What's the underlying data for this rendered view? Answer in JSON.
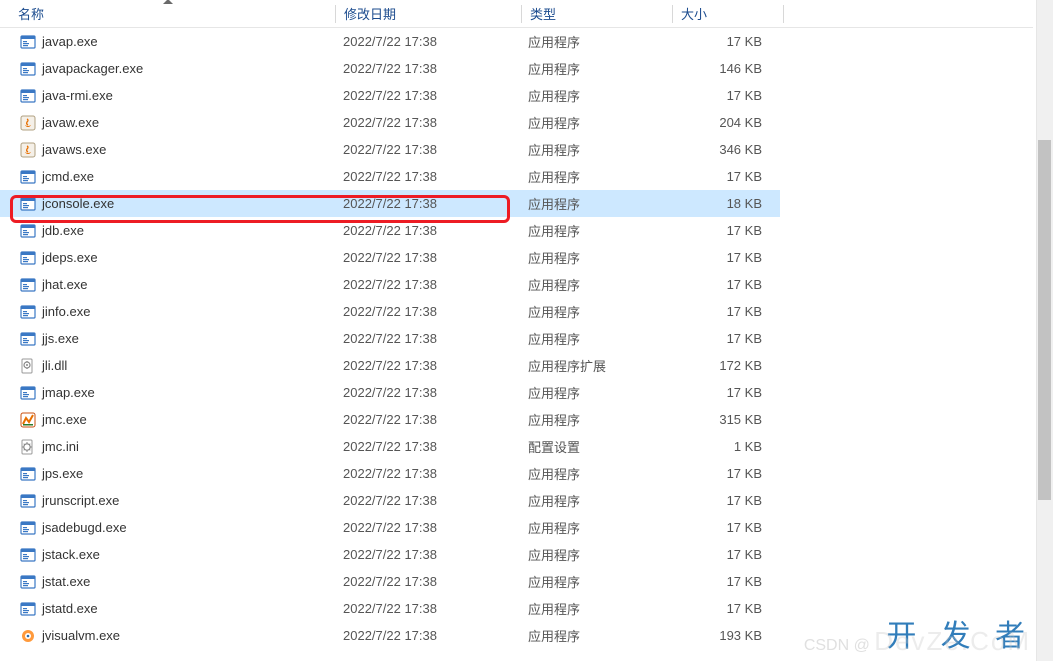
{
  "columns": {
    "name": "名称",
    "date": "修改日期",
    "type": "类型",
    "size": "大小"
  },
  "file_types": {
    "app": "应用程序",
    "app_ext": "应用程序扩展",
    "config": "配置设置"
  },
  "files": [
    {
      "name": "javap.exe",
      "date": "2022/7/22 17:38",
      "type": "app",
      "size": "17 KB",
      "icon": "exe"
    },
    {
      "name": "javapackager.exe",
      "date": "2022/7/22 17:38",
      "type": "app",
      "size": "146 KB",
      "icon": "exe"
    },
    {
      "name": "java-rmi.exe",
      "date": "2022/7/22 17:38",
      "type": "app",
      "size": "17 KB",
      "icon": "exe"
    },
    {
      "name": "javaw.exe",
      "date": "2022/7/22 17:38",
      "type": "app",
      "size": "204 KB",
      "icon": "java"
    },
    {
      "name": "javaws.exe",
      "date": "2022/7/22 17:38",
      "type": "app",
      "size": "346 KB",
      "icon": "java"
    },
    {
      "name": "jcmd.exe",
      "date": "2022/7/22 17:38",
      "type": "app",
      "size": "17 KB",
      "icon": "exe"
    },
    {
      "name": "jconsole.exe",
      "date": "2022/7/22 17:38",
      "type": "app",
      "size": "18 KB",
      "icon": "exe",
      "selected": true
    },
    {
      "name": "jdb.exe",
      "date": "2022/7/22 17:38",
      "type": "app",
      "size": "17 KB",
      "icon": "exe"
    },
    {
      "name": "jdeps.exe",
      "date": "2022/7/22 17:38",
      "type": "app",
      "size": "17 KB",
      "icon": "exe"
    },
    {
      "name": "jhat.exe",
      "date": "2022/7/22 17:38",
      "type": "app",
      "size": "17 KB",
      "icon": "exe"
    },
    {
      "name": "jinfo.exe",
      "date": "2022/7/22 17:38",
      "type": "app",
      "size": "17 KB",
      "icon": "exe"
    },
    {
      "name": "jjs.exe",
      "date": "2022/7/22 17:38",
      "type": "app",
      "size": "17 KB",
      "icon": "exe"
    },
    {
      "name": "jli.dll",
      "date": "2022/7/22 17:38",
      "type": "app_ext",
      "size": "172 KB",
      "icon": "dll"
    },
    {
      "name": "jmap.exe",
      "date": "2022/7/22 17:38",
      "type": "app",
      "size": "17 KB",
      "icon": "exe"
    },
    {
      "name": "jmc.exe",
      "date": "2022/7/22 17:38",
      "type": "app",
      "size": "315 KB",
      "icon": "jmc"
    },
    {
      "name": "jmc.ini",
      "date": "2022/7/22 17:38",
      "type": "config",
      "size": "1 KB",
      "icon": "ini"
    },
    {
      "name": "jps.exe",
      "date": "2022/7/22 17:38",
      "type": "app",
      "size": "17 KB",
      "icon": "exe"
    },
    {
      "name": "jrunscript.exe",
      "date": "2022/7/22 17:38",
      "type": "app",
      "size": "17 KB",
      "icon": "exe"
    },
    {
      "name": "jsadebugd.exe",
      "date": "2022/7/22 17:38",
      "type": "app",
      "size": "17 KB",
      "icon": "exe"
    },
    {
      "name": "jstack.exe",
      "date": "2022/7/22 17:38",
      "type": "app",
      "size": "17 KB",
      "icon": "exe"
    },
    {
      "name": "jstat.exe",
      "date": "2022/7/22 17:38",
      "type": "app",
      "size": "17 KB",
      "icon": "exe"
    },
    {
      "name": "jstatd.exe",
      "date": "2022/7/22 17:38",
      "type": "app",
      "size": "17 KB",
      "icon": "exe"
    },
    {
      "name": "jvisualvm.exe",
      "date": "2022/7/22 17:38",
      "type": "app",
      "size": "193 KB",
      "icon": "jvv"
    }
  ],
  "watermark": {
    "main": "开 发 者",
    "sub_prefix": "CSDN @",
    "sub_brand": "DevZe.CoM"
  }
}
